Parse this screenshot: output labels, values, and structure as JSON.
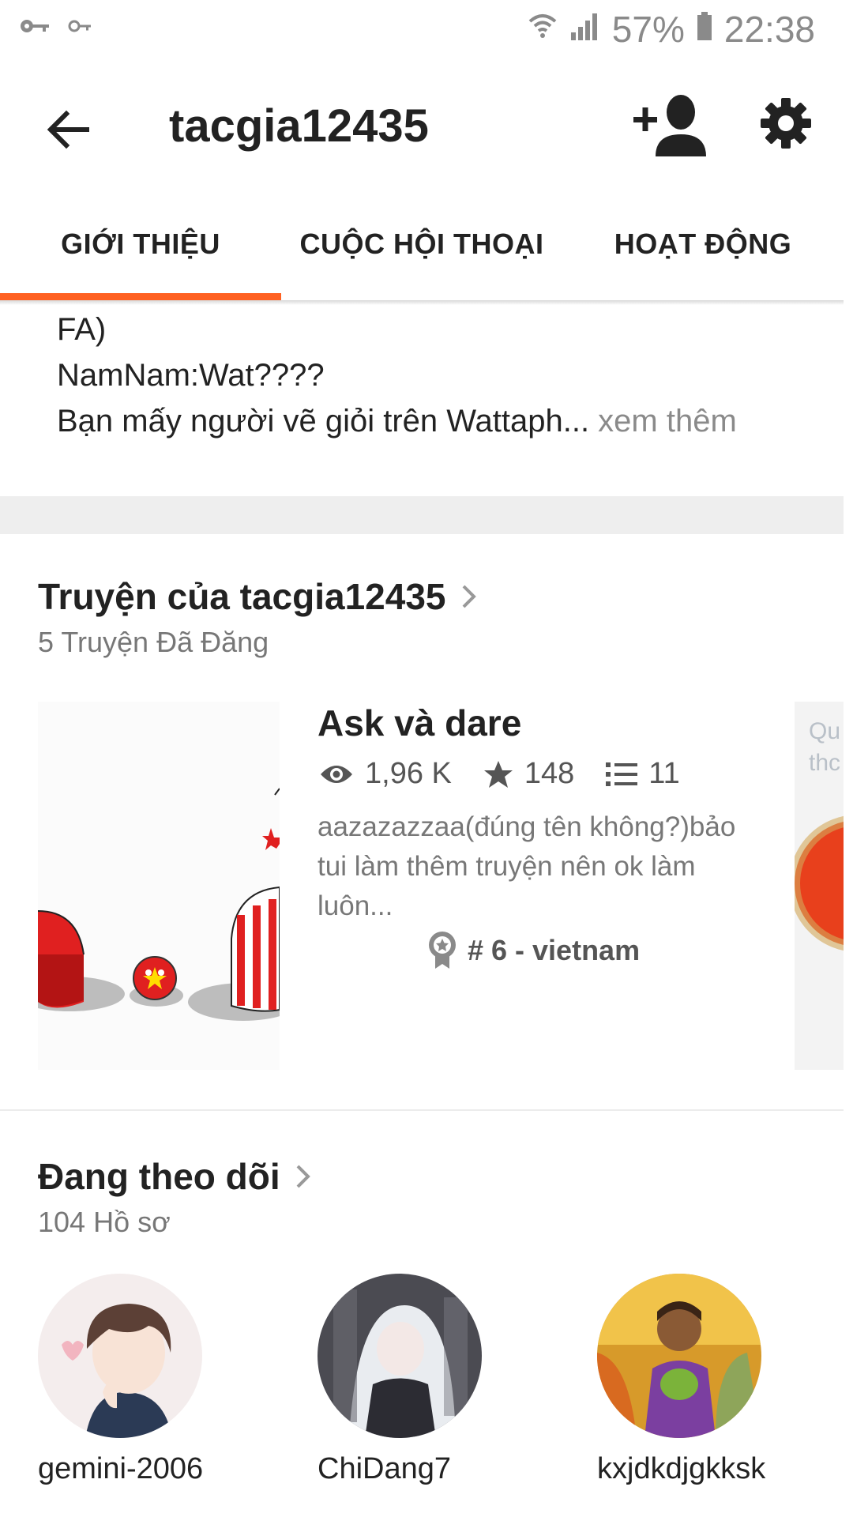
{
  "status_bar": {
    "battery": "57%",
    "time": "22:38"
  },
  "app_bar": {
    "title": "tacgia12435"
  },
  "tabs": [
    {
      "label": "GIỚI THIỆU"
    },
    {
      "label": "CUỘC HỘI THOẠI"
    },
    {
      "label": "HOẠT ĐỘNG"
    }
  ],
  "bio": {
    "lines": [
      "FA)",
      "NamNam:Wat????",
      "Bạn mấy người vẽ giỏi trên Wattaph..."
    ],
    "more": " xem thêm"
  },
  "stories": {
    "title": "Truyện của tacgia12435",
    "subtitle": "5 Truyện Đã Đăng",
    "items": [
      {
        "title": "Ask và dare",
        "views": "1,96 K",
        "votes": "148",
        "parts": "11",
        "description": "aazazazzaa(đúng tên không?)bảo tui làm thêm truyện nên ok làm luôn...",
        "rank": "# 6 - vietnam"
      }
    ],
    "next_cover_text": "Qu\nthc"
  },
  "following": {
    "title": "Đang theo dõi",
    "subtitle": "104 Hồ sơ",
    "users": [
      {
        "name": "gemini-2006"
      },
      {
        "name": "ChiDang7"
      },
      {
        "name": "kxjdkdjgkksk"
      }
    ]
  },
  "colors": {
    "accent": "#ff6122",
    "text_primary": "#222222",
    "text_secondary": "#777777",
    "divider": "#eeeeee"
  }
}
